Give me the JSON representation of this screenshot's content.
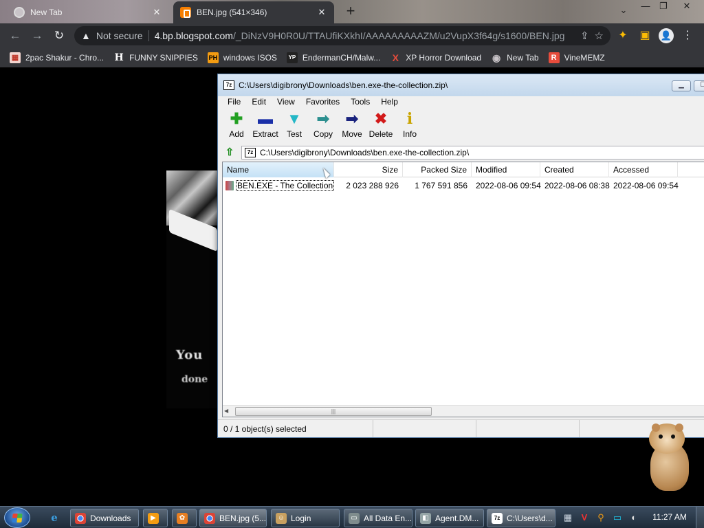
{
  "browser": {
    "tabs": [
      {
        "title": "New Tab",
        "close": "✕"
      },
      {
        "title": "BEN.jpg (541×346)",
        "close": "✕"
      }
    ],
    "new_tab": "+",
    "window_controls": {
      "tab_search": "⌄",
      "minimize": "—",
      "maximize": "❐",
      "close": "✕"
    },
    "nav": {
      "back": "←",
      "forward": "→",
      "reload": "↻"
    },
    "omnibox": {
      "warning_icon": "▲",
      "not_secure": "Not secure",
      "host": "4.bp.blogspot.com",
      "path": "/_DiNzV9H0R0U/TTAUfiKXkhI/AAAAAAAAAZM/u2VupX3f64g/s1600/BEN.jpg",
      "share_icon": "⇪",
      "star_icon": "☆"
    },
    "toolbar_icons": {
      "extensions": "✦",
      "side_panel": "▣",
      "profile": "👤",
      "menu": "⋮"
    },
    "bookmarks": [
      {
        "label": "2pac Shakur - Chro...",
        "icon": "▦",
        "color": "#c0392b"
      },
      {
        "label": "FUNNY SNIPPIES",
        "icon": "H",
        "color": "#ffffff"
      },
      {
        "label": "windows ISOS",
        "icon": "PH",
        "color": "#f39c12"
      },
      {
        "label": "EndermanCH/Malw...",
        "icon": "YP",
        "color": "#ffffff"
      },
      {
        "label": "XP Horror Download",
        "icon": "X",
        "color": "#e74c3c"
      },
      {
        "label": "New Tab",
        "icon": "◉",
        "color": "#c9c4c8"
      },
      {
        "label": "VineMEMZ",
        "icon": "R",
        "color": "#e74c3c"
      }
    ]
  },
  "image_page": {
    "text_line1": "You",
    "text_line2": "done"
  },
  "zip": {
    "app_icon": "7z",
    "title": "C:\\Users\\digibrony\\Downloads\\ben.exe-the-collection.zip\\",
    "window_controls": {
      "minimize": "▁",
      "maximize": "☐"
    },
    "menu": [
      "File",
      "Edit",
      "View",
      "Favorites",
      "Tools",
      "Help"
    ],
    "toolbar": [
      {
        "label": "Add",
        "glyph": "✚"
      },
      {
        "label": "Extract",
        "glyph": "▬"
      },
      {
        "label": "Test",
        "glyph": "▼"
      },
      {
        "label": "Copy",
        "glyph": "➡"
      },
      {
        "label": "Move",
        "glyph": "➡"
      },
      {
        "label": "Delete",
        "glyph": "✖"
      },
      {
        "label": "Info",
        "glyph": "i"
      }
    ],
    "up_icon": "⇧",
    "path": "C:\\Users\\digibrony\\Downloads\\ben.exe-the-collection.zip\\",
    "columns": [
      "Name",
      "Size",
      "Packed Size",
      "Modified",
      "Created",
      "Accessed"
    ],
    "rows": [
      {
        "name": "BEN.EXE - The Collection",
        "size": "2 023 288 926",
        "packed": "1 767 591 856",
        "modified": "2022-08-06 09:54",
        "created": "2022-08-06 08:38",
        "accessed": "2022-08-06 09:54"
      }
    ],
    "scroll_left": "◀",
    "scroll_grip": "|||",
    "status": "0 / 1 object(s) selected"
  },
  "taskbar": {
    "ie_icon": "e",
    "tasks": [
      {
        "label": "Downloads"
      },
      {
        "label": ""
      },
      {
        "label": ""
      },
      {
        "label": "BEN.jpg (5..."
      },
      {
        "label": "Login"
      },
      {
        "label": "All Data En..."
      },
      {
        "label": "Agent.DM..."
      },
      {
        "label": "C:\\Users\\d..."
      }
    ],
    "tray": [
      "▦",
      "V",
      "⚲",
      "▭",
      "◐"
    ],
    "clock": "11:27 AM"
  }
}
